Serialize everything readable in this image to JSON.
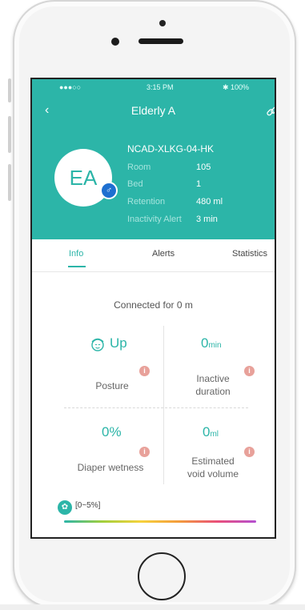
{
  "status_bar": {
    "signal": "●●●○○",
    "time": "3:15 PM",
    "battery": "✱ 100%"
  },
  "header": {
    "title": "Elderly A",
    "back_icon": "chevron-left-icon",
    "link_icon": "link-icon"
  },
  "profile": {
    "initials": "EA",
    "gender_symbol": "♂",
    "device_id": "NCAD-XLKG-04-HK",
    "fields": [
      {
        "key": "Room",
        "value": "105"
      },
      {
        "key": "Bed",
        "value": "1"
      },
      {
        "key": "Retention",
        "value": "480 ml"
      },
      {
        "key": "Inactivity Alert",
        "value": "3 min"
      }
    ]
  },
  "tabs": [
    {
      "label": "Info",
      "active": true
    },
    {
      "label": "Alerts",
      "active": false
    },
    {
      "label": "Statistics",
      "active": false
    }
  ],
  "info": {
    "connected": "Connected for 0 m",
    "posture": {
      "value": "Up",
      "label": "Posture"
    },
    "inactive": {
      "value": "0",
      "unit": "min",
      "label_line1": "Inactive",
      "label_line2": "duration"
    },
    "wetness": {
      "value": "0%",
      "label": "Diaper wetness"
    },
    "void": {
      "value": "0",
      "unit": "ml",
      "label_line1": "Estimated",
      "label_line2": "void volume"
    },
    "info_symbol": "i"
  },
  "legend": {
    "range": "[0~5%]",
    "icon": "diaper-icon"
  },
  "colors": {
    "accent": "#2cb5a8",
    "info_dot": "#e8a19a",
    "gender": "#1e6fd0"
  }
}
